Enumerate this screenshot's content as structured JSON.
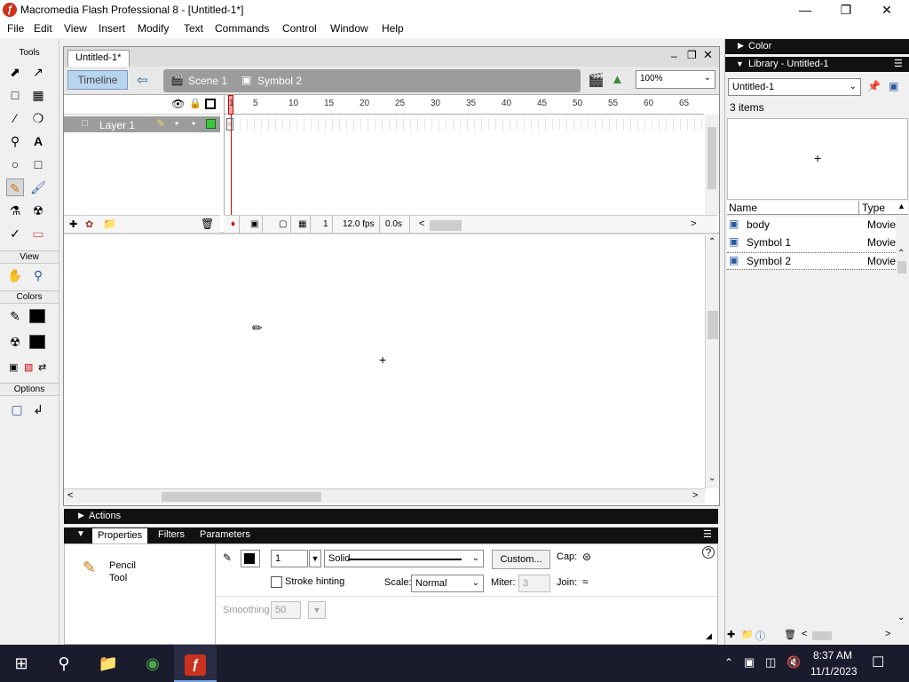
{
  "window": {
    "title": "Macromedia Flash Professional 8 - [Untitled-1*]",
    "app_icon": "flash-logo-icon",
    "controls": [
      "minimize-icon",
      "maximize-icon",
      "close-icon"
    ]
  },
  "menu": [
    "File",
    "Edit",
    "View",
    "Insert",
    "Modify",
    "Text",
    "Commands",
    "Control",
    "Window",
    "Help"
  ],
  "tools": {
    "title": "Tools",
    "view_label": "View",
    "colors_label": "Colors",
    "options_label": "Options",
    "stroke_color": "#000000",
    "fill_color": "#000000"
  },
  "document": {
    "tab": "Untitled-1*",
    "timeline_button": "Timeline",
    "scene": "Scene 1",
    "symbol": "Symbol 2",
    "zoom": "100%"
  },
  "timeline": {
    "layer_name": "Layer 1",
    "ruler_ticks": [
      "1",
      "5",
      "10",
      "15",
      "20",
      "25",
      "30",
      "35",
      "40",
      "45",
      "50",
      "55",
      "60",
      "65"
    ],
    "current_frame": "1",
    "fps": "12.0 fps",
    "elapsed": "0.0s"
  },
  "panels": {
    "actions": "Actions",
    "properties_tab": "Properties",
    "filters_tab": "Filters",
    "parameters_tab": "Parameters"
  },
  "properties": {
    "tool_name_line1": "Pencil",
    "tool_name_line2": "Tool",
    "stroke_width": "1",
    "stroke_style": "Solid",
    "custom_button": "Custom...",
    "cap_label": "Cap:",
    "stroke_hinting": "Stroke hinting",
    "scale_label": "Scale:",
    "scale_value": "Normal",
    "miter_label": "Miter:",
    "miter_value": "3",
    "join_label": "Join:",
    "smoothing_label": "Smoothing",
    "smoothing_value": "50"
  },
  "right": {
    "color_panel": "Color",
    "library_panel": "Library - Untitled-1",
    "library_select": "Untitled-1",
    "item_count": "3 items",
    "col_name": "Name",
    "col_type": "Type",
    "items": [
      {
        "name": "body",
        "type": "Movie"
      },
      {
        "name": "Symbol 1",
        "type": "Movie"
      },
      {
        "name": "Symbol 2",
        "type": "Movie"
      }
    ]
  },
  "taskbar": {
    "time": "8:37 AM",
    "date": "11/1/2023"
  }
}
